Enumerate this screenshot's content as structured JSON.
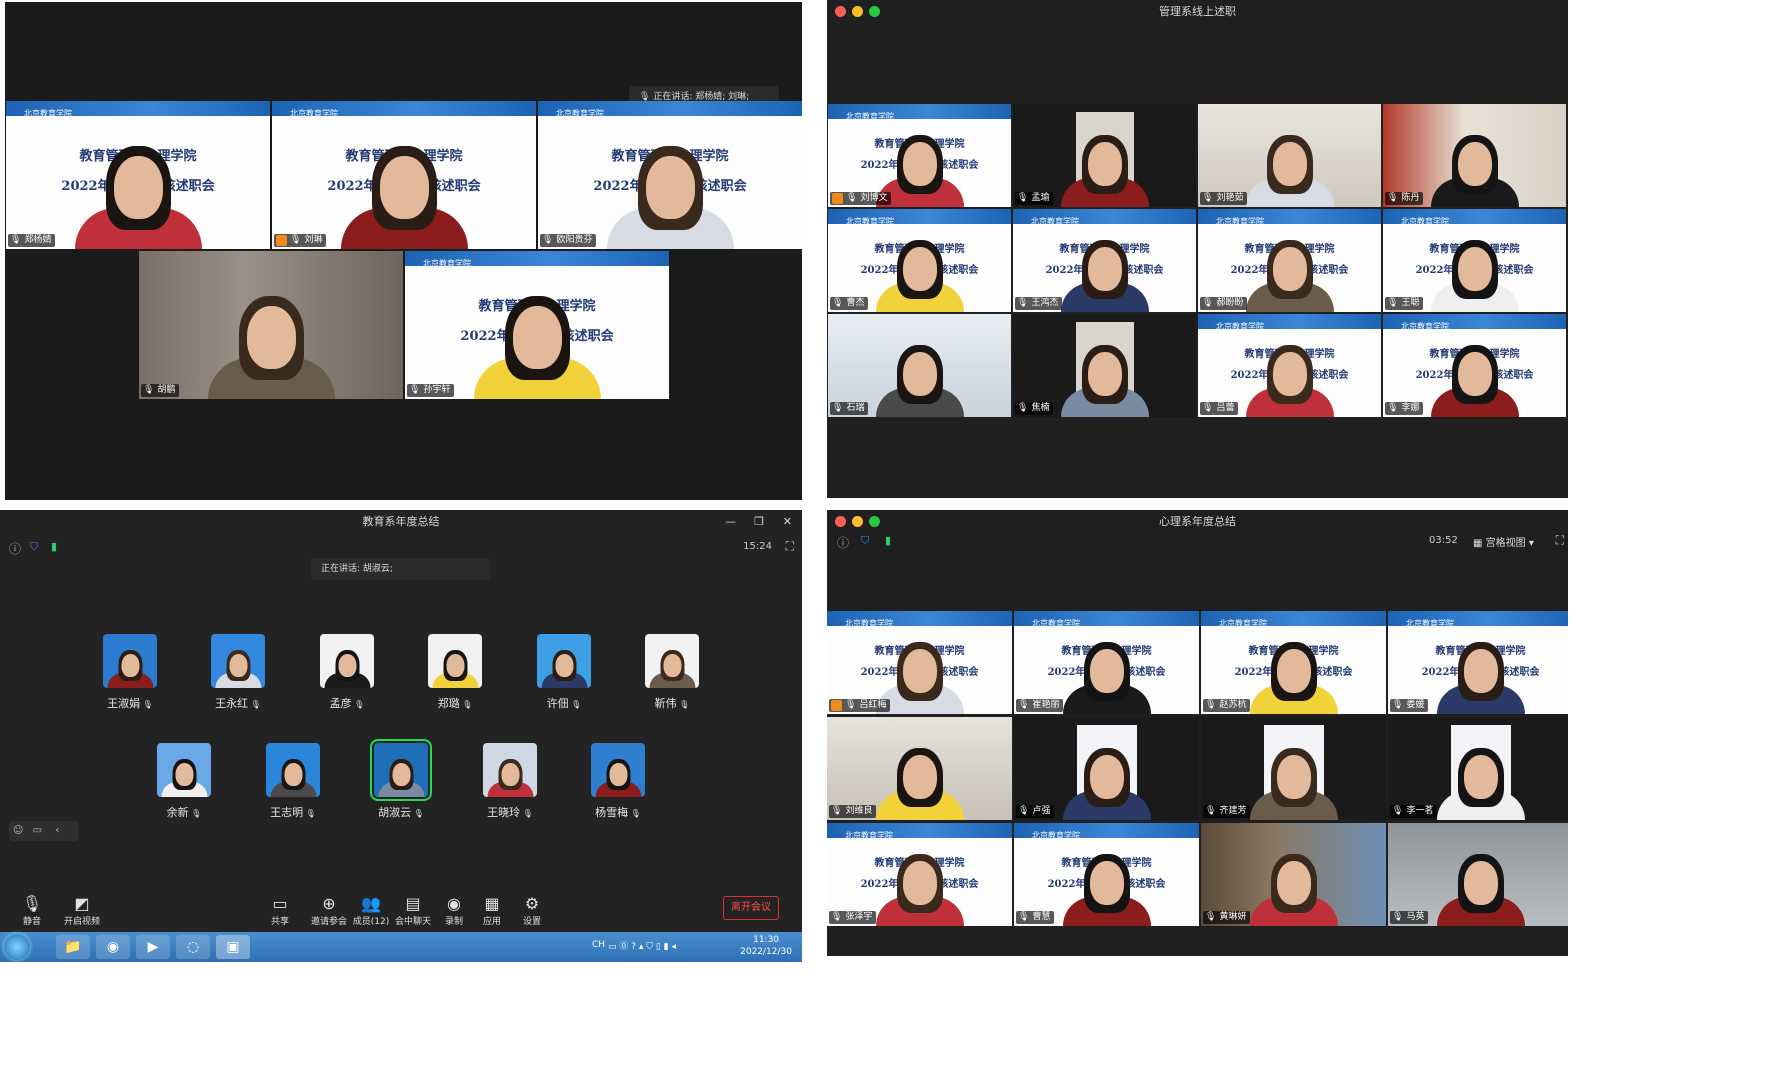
{
  "panel1": {
    "speaking_text": "正在讲话: 郑杨婧; 刘琳;",
    "slide": {
      "header": "北京教育学院",
      "line1": "教育管理与心理学院",
      "line2": "2022年度教师考核述职会"
    },
    "tiles": [
      {
        "name": "郑杨婧",
        "host": false
      },
      {
        "name": "刘琳",
        "host": true
      },
      {
        "name": "欧阳贵芬",
        "host": false
      },
      {
        "name": "胡鹏",
        "host": false
      },
      {
        "name": "孙宇轩",
        "host": false
      }
    ]
  },
  "panel2": {
    "title": "管理系线上述职",
    "tiles": [
      {
        "name": "刘博文",
        "host": true
      },
      {
        "name": "孟瑜"
      },
      {
        "name": "刘艳茹"
      },
      {
        "name": "陈丹"
      },
      {
        "name": "曹杰"
      },
      {
        "name": "王鸿杰"
      },
      {
        "name": "郝盼盼"
      },
      {
        "name": "王聪"
      },
      {
        "name": "石瑞"
      },
      {
        "name": "焦楠"
      },
      {
        "name": "吕蕾"
      },
      {
        "name": "李娜"
      }
    ]
  },
  "panel3": {
    "title": "教育系年度总结",
    "time": "15:24",
    "speaking_text": "正在讲话: 胡淑云;",
    "participants": [
      "王淑娟",
      "王永红",
      "孟彦",
      "郑璐",
      "许佃",
      "靳伟",
      "余新",
      "王志明",
      "胡淑云",
      "王晓玲",
      "杨雪梅"
    ],
    "toolbar": {
      "mute": "静音",
      "video": "开启视频",
      "share": "共享",
      "invite": "邀请参会",
      "members": "成员(12)",
      "chat": "会中聊天",
      "record": "录制",
      "apps": "应用",
      "settings": "设置",
      "leave": "离开会议"
    },
    "taskbar": {
      "lang": "CH",
      "clock_time": "11:30",
      "clock_date": "2022/12/30"
    }
  },
  "panel4": {
    "title": "心理系年度总结",
    "time": "03:52",
    "view_label": "宫格视图",
    "tiles": [
      {
        "name": "吕红梅",
        "host": true
      },
      {
        "name": "崔艳丽"
      },
      {
        "name": "赵苏杭"
      },
      {
        "name": "娄媛"
      },
      {
        "name": "刘维良"
      },
      {
        "name": "卢强"
      },
      {
        "name": "齐建芳"
      },
      {
        "name": "李一茗"
      },
      {
        "name": "张泽宇"
      },
      {
        "name": "曹慧"
      },
      {
        "name": "黄琳妍"
      },
      {
        "name": "马英"
      }
    ]
  },
  "colors": {
    "panel_bg": "#1b1b1b",
    "active_border": "#23d959",
    "host_badge": "#f08a1c",
    "leave_red": "#e02e2e",
    "slide_blue": "#1d63b3",
    "slide_text": "#233a74"
  }
}
